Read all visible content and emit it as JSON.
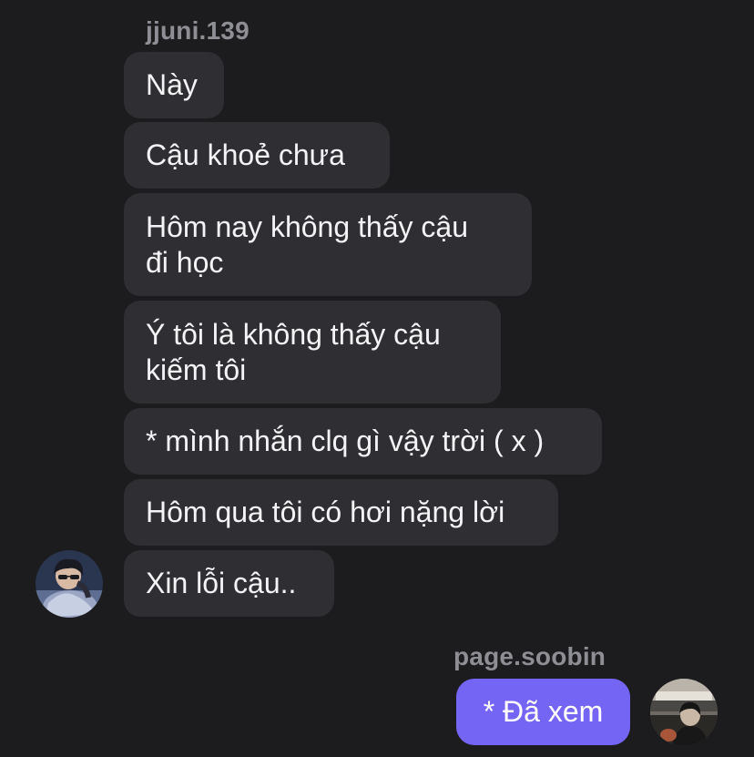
{
  "incoming": {
    "sender": "jjuni.139",
    "messages": [
      {
        "text": "Này"
      },
      {
        "text": "Cậu khoẻ chưa"
      },
      {
        "text": "Hôm nay không thấy cậu\nđi học"
      },
      {
        "text": "Ý tôi là không thấy cậu\nkiếm tôi"
      },
      {
        "text": "* mình nhắn clq gì vậy trời ( x )"
      },
      {
        "text": "Hôm qua tôi có hơi nặng lời"
      },
      {
        "text": "Xin lỗi cậu.."
      }
    ]
  },
  "outgoing": {
    "sender": "page.soobin",
    "messages": [
      {
        "text": "* Đã xem"
      }
    ]
  },
  "colors": {
    "background": "#1c1c1f",
    "incoming_bubble": "#2f2f33",
    "outgoing_bubble": "#7565f5",
    "sender_name": "#8e8e95"
  },
  "icons": {
    "incoming_avatar": "avatar-photo",
    "outgoing_avatar": "avatar-photo"
  }
}
